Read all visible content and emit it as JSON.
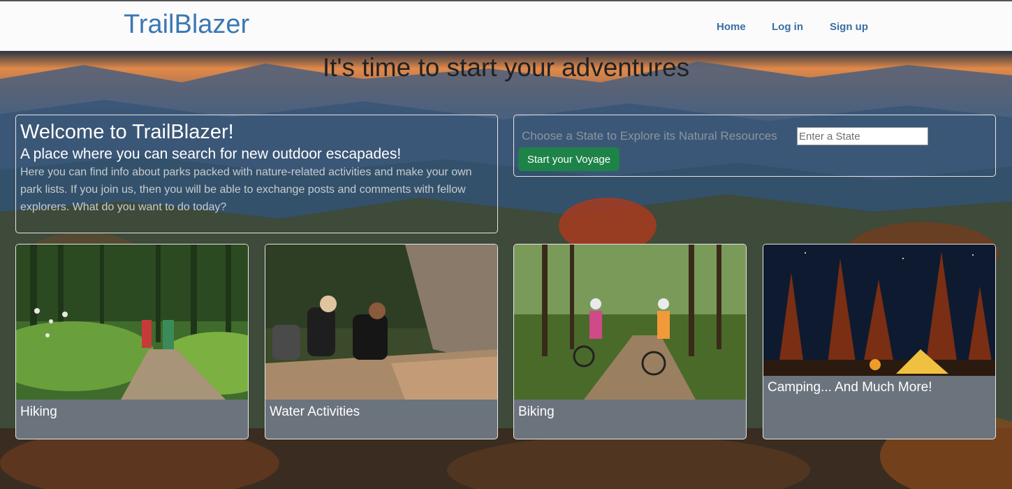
{
  "navbar": {
    "brand": "TrailBlazer",
    "links": [
      "Home",
      "Log in",
      "Sign up"
    ]
  },
  "hero": {
    "title": "It's time to start your adventures"
  },
  "welcome": {
    "heading": "Welcome to TrailBlazer!",
    "subheading": "A place where you can search for new outdoor escapades!",
    "body": "Here you can find info about parks packed with nature-related activities and make your own park lists. If you join us, then you will be able to exchange posts and comments with fellow explorers. What do you want to do today?"
  },
  "search": {
    "label": "Choose a State to Explore its Natural Resources",
    "placeholder": "Enter a State",
    "value": "",
    "button": "Start your Voyage"
  },
  "cards": [
    {
      "title": "Hiking",
      "image": "hikers-on-forest-trail"
    },
    {
      "title": "Water Activities",
      "image": "couple-by-stream"
    },
    {
      "title": "Biking",
      "image": "cyclists-walking-bikes-in-forest"
    },
    {
      "title": "Camping... And Much More!",
      "image": "tent-campfire-night-forest"
    }
  ],
  "colors": {
    "brand": "#3a78b4",
    "button": "#1d8348",
    "card_body": "#6b737d"
  }
}
